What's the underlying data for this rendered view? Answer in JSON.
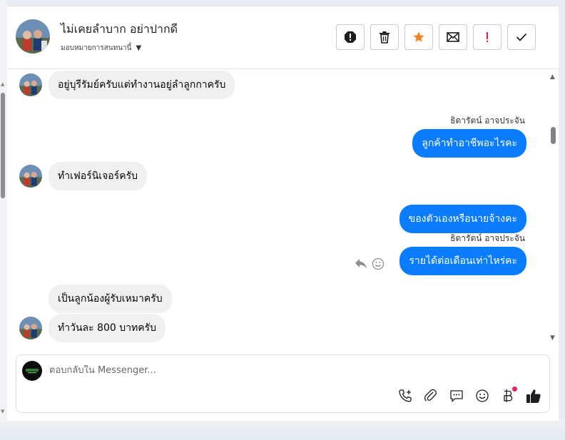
{
  "contact": {
    "name": "ไม่เคยลำบาก อย่าปากดี",
    "assign_label": "มอบหมายการสนทนานี้"
  },
  "actions": [
    {
      "name": "spam-icon"
    },
    {
      "name": "trash-icon"
    },
    {
      "name": "star-icon",
      "color": "#f5821f"
    },
    {
      "name": "mail-icon"
    },
    {
      "name": "follow-up-icon",
      "color": "#e41e3f"
    },
    {
      "name": "check-icon"
    }
  ],
  "messages": {
    "m1": "อยู่บุรีรัมย์ครับแต่ทำงานอยู่ลำลูกกาครับ",
    "s1": "ธิดารัตน์ อาจประจัน",
    "m2": "ลูกค้าทำอาชีพอะไรคะ",
    "m3": "ทำเฟอร์นิเจอร์ครับ",
    "m4": "ของตัวเองหรือนายจ้างคะ",
    "s2": "ธิดารัตน์ อาจประจัน",
    "m5": "รายได้ต่อเดือนเท่าไหร่คะ",
    "m6": "เป็นลูกน้องผู้รับเหมาครับ",
    "m7": "ทำวันละ 800 บาทครับ"
  },
  "reply": {
    "placeholder": "ตอบกลับใน Messenger..."
  },
  "colors": {
    "outgoing": "#0a7cff",
    "incoming": "#f0f0f0"
  }
}
